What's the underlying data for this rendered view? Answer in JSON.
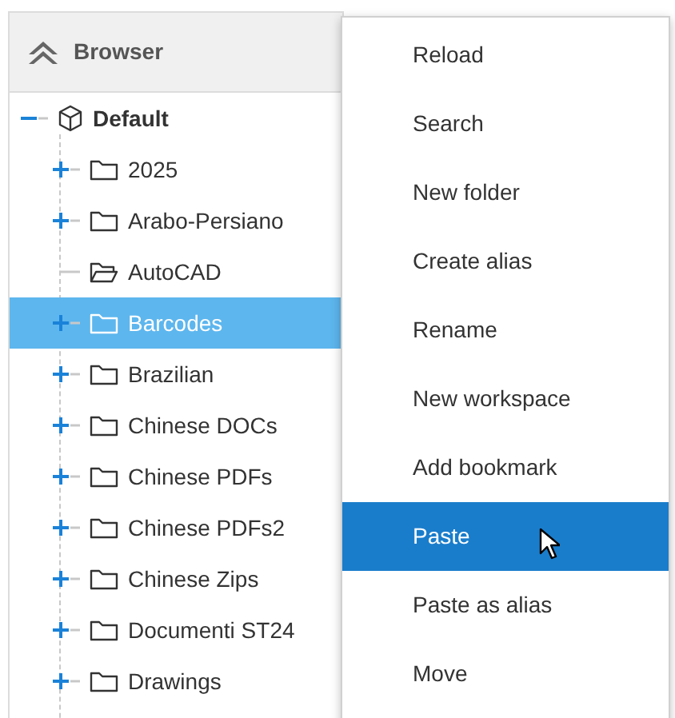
{
  "panel": {
    "title": "Browser"
  },
  "tree": {
    "label": "Default",
    "expanded": true,
    "children": [
      {
        "label": "2025",
        "has_children": true,
        "selected": false
      },
      {
        "label": "Arabo-Persiano",
        "has_children": true,
        "selected": false
      },
      {
        "label": "AutoCAD",
        "has_children": false,
        "selected": false
      },
      {
        "label": "Barcodes",
        "has_children": true,
        "selected": true
      },
      {
        "label": "Brazilian",
        "has_children": true,
        "selected": false
      },
      {
        "label": "Chinese DOCs",
        "has_children": true,
        "selected": false
      },
      {
        "label": "Chinese PDFs",
        "has_children": true,
        "selected": false
      },
      {
        "label": "Chinese PDFs2",
        "has_children": true,
        "selected": false
      },
      {
        "label": "Chinese Zips",
        "has_children": true,
        "selected": false
      },
      {
        "label": "Documenti ST24",
        "has_children": true,
        "selected": false
      },
      {
        "label": "Drawings",
        "has_children": true,
        "selected": false
      }
    ]
  },
  "context_menu": [
    {
      "label": "Reload",
      "selected": false
    },
    {
      "label": "Search",
      "selected": false
    },
    {
      "label": "New folder",
      "selected": false
    },
    {
      "label": "Create alias",
      "selected": false
    },
    {
      "label": "Rename",
      "selected": false
    },
    {
      "label": "New workspace",
      "selected": false
    },
    {
      "label": "Add bookmark",
      "selected": false
    },
    {
      "label": "Paste",
      "selected": true
    },
    {
      "label": "Paste as alias",
      "selected": false
    },
    {
      "label": "Move",
      "selected": false
    }
  ]
}
